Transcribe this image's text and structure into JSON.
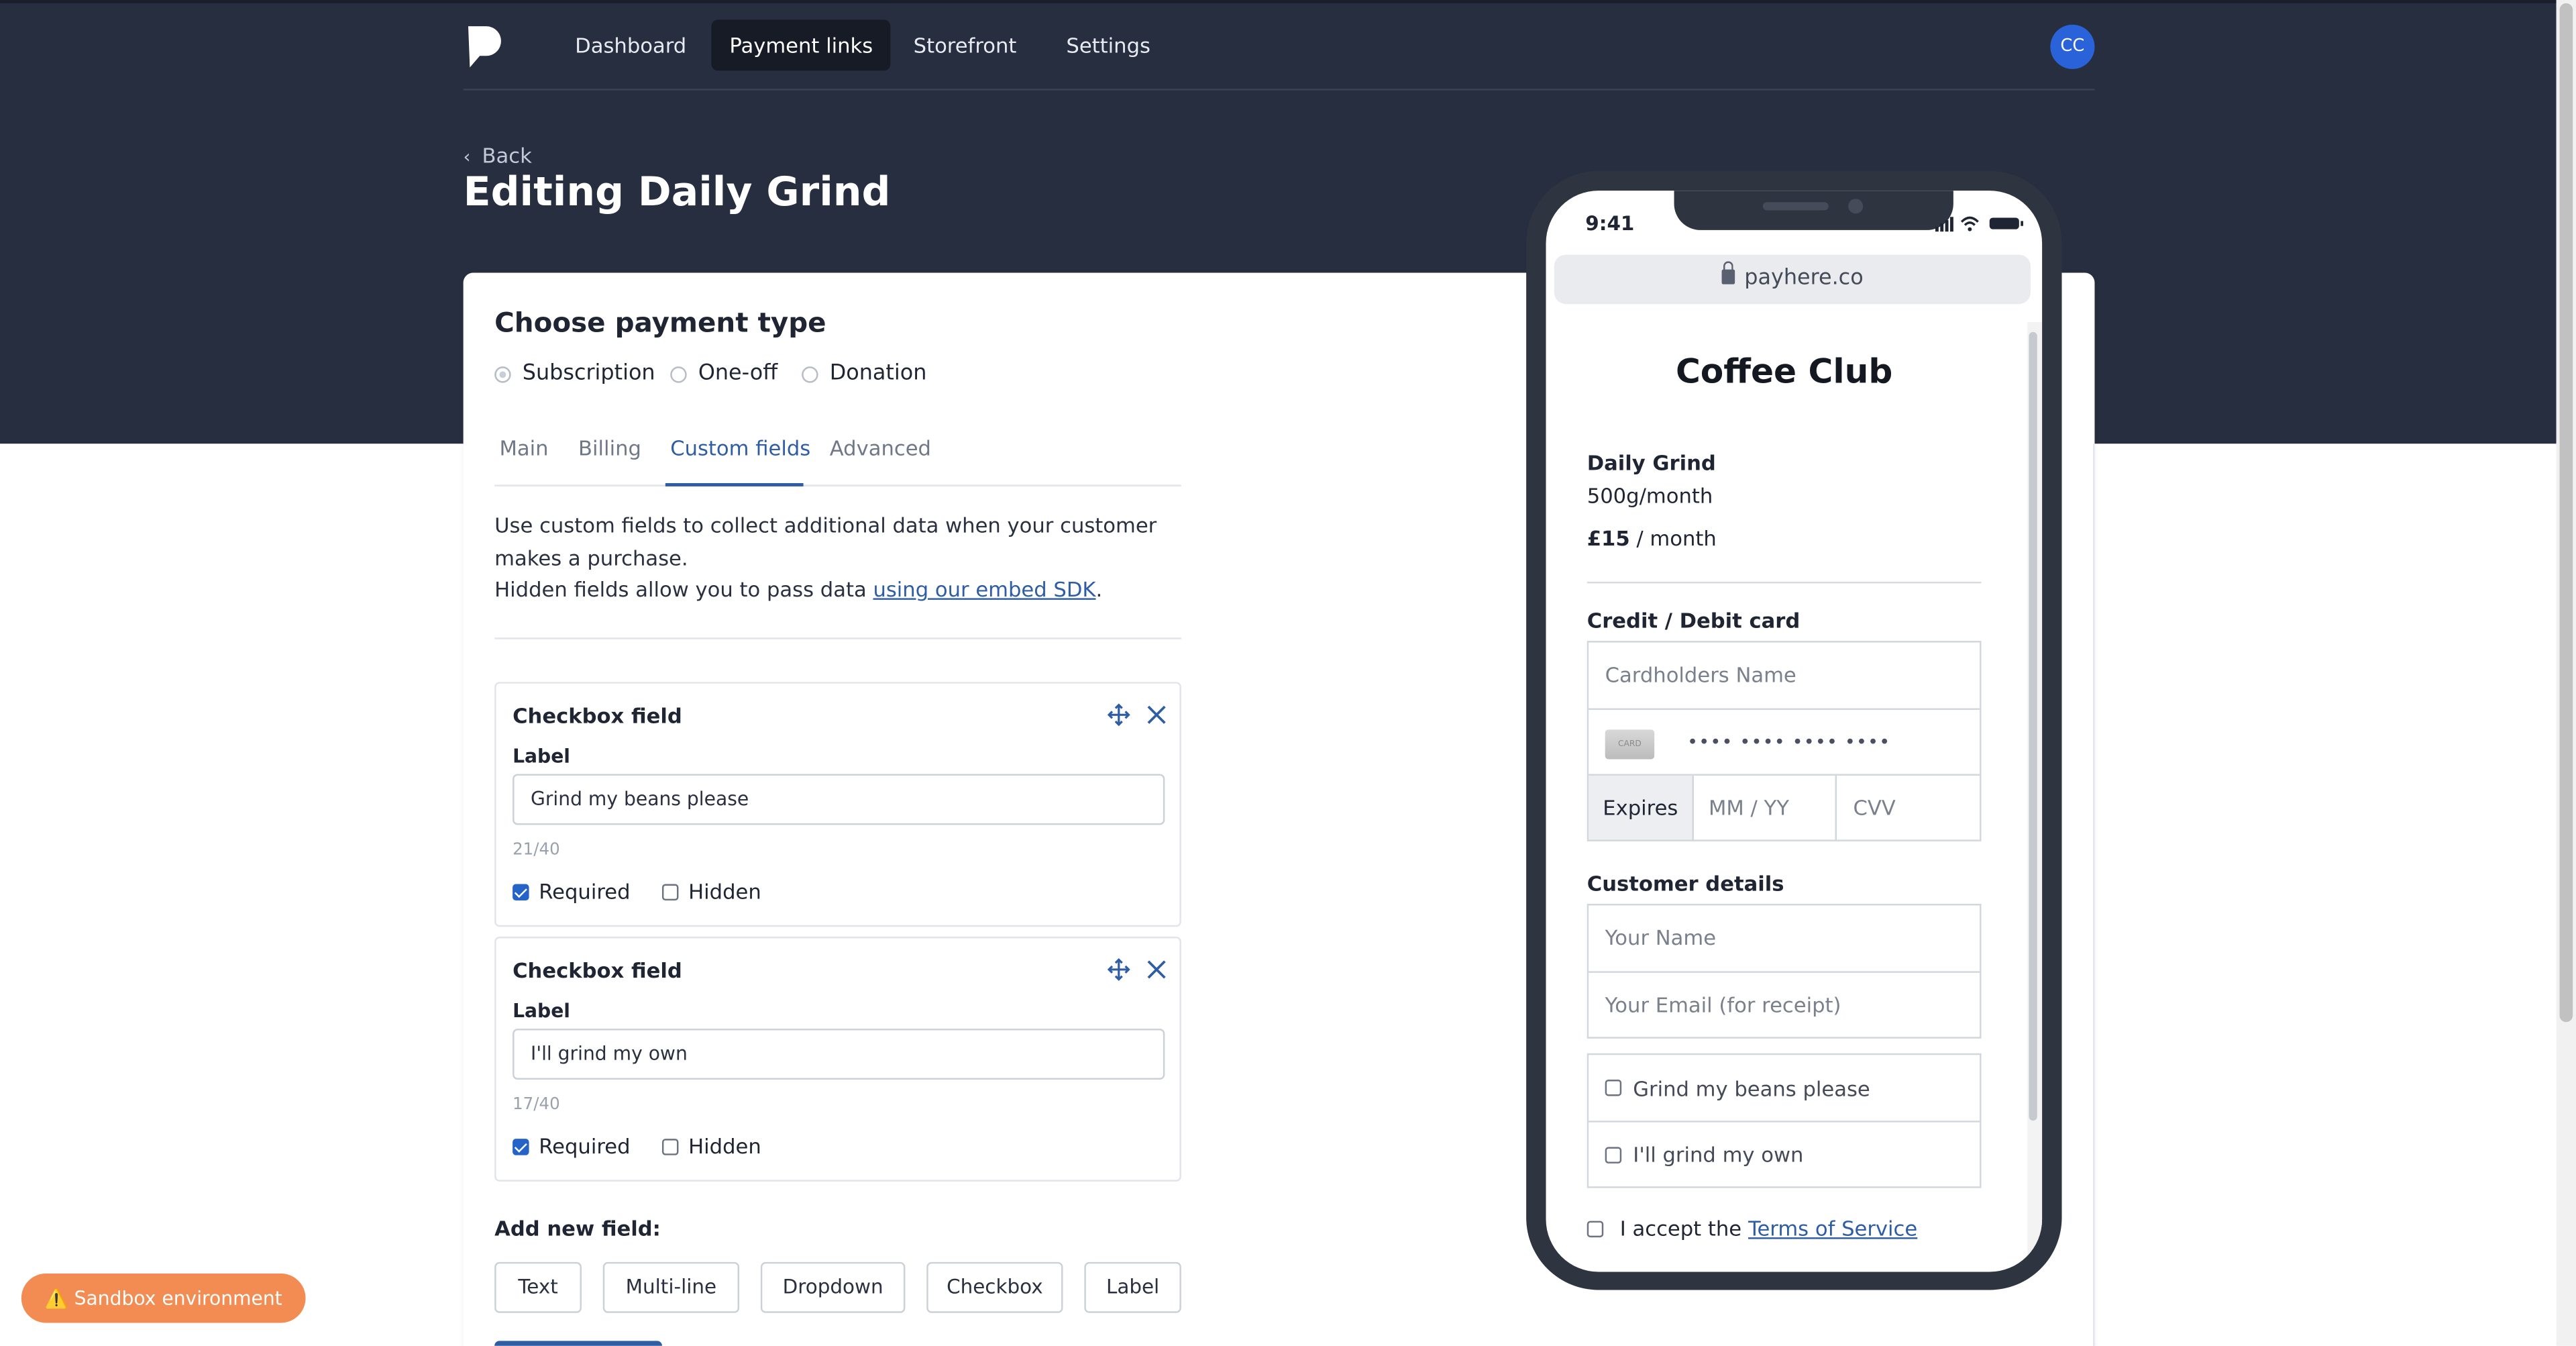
{
  "nav": {
    "items": [
      {
        "label": "Dashboard"
      },
      {
        "label": "Payment links"
      },
      {
        "label": "Storefront"
      },
      {
        "label": "Settings"
      }
    ],
    "active": "Payment links",
    "avatar_initials": "CC",
    "logo_icon": "payhere-logo-icon"
  },
  "header": {
    "back_label": "Back",
    "title": "Editing Daily Grind"
  },
  "payment_type": {
    "title": "Choose payment type",
    "options": [
      {
        "label": "Subscription",
        "selected": true
      },
      {
        "label": "One-off",
        "selected": false
      },
      {
        "label": "Donation",
        "selected": false
      }
    ]
  },
  "tabs": [
    {
      "label": "Main"
    },
    {
      "label": "Billing"
    },
    {
      "label": "Custom fields"
    },
    {
      "label": "Advanced"
    }
  ],
  "active_tab": "Custom fields",
  "custom_fields": {
    "description_line1": "Use custom fields to collect additional data when your customer makes a purchase.",
    "description_line2_prefix": "Hidden fields allow you to pass data ",
    "description_link": "using our embed SDK",
    "description_line2_suffix": ".",
    "fields": [
      {
        "type_title": "Checkbox field",
        "label_caption": "Label",
        "value": "Grind my beans please",
        "counter": "21/40",
        "required_label": "Required",
        "required": true,
        "hidden_label": "Hidden",
        "hidden": false
      },
      {
        "type_title": "Checkbox field",
        "label_caption": "Label",
        "value": "I'll grind my own",
        "counter": "17/40",
        "required_label": "Required",
        "required": true,
        "hidden_label": "Hidden",
        "hidden": false
      }
    ],
    "add_title": "Add new field:",
    "add_buttons": [
      {
        "label": "Text"
      },
      {
        "label": "Multi-line"
      },
      {
        "label": "Dropdown"
      },
      {
        "label": "Checkbox"
      },
      {
        "label": "Label"
      }
    ]
  },
  "sandbox_badge": "⚠️ Sandbox environment",
  "preview": {
    "time": "9:41",
    "url": "payhere.co",
    "shop_name": "Coffee Club",
    "product_name": "Daily Grind",
    "product_desc": "500g/month",
    "price_amount": "£15",
    "price_period": " / month",
    "card_section": "Credit / Debit card",
    "cardholder_placeholder": "Cardholders Name",
    "card_image_text": "CARD",
    "card_number_mask": "•••• •••• •••• ••••",
    "expires_label": "Expires",
    "expiry_placeholder": "MM / YY",
    "cvv_placeholder": "CVV",
    "customer_section": "Customer details",
    "name_placeholder": "Your Name",
    "email_placeholder": "Your Email (for receipt)",
    "custom_checkboxes": [
      {
        "label": "Grind my beans please"
      },
      {
        "label": "I'll grind my own"
      }
    ],
    "terms_prefix": "I accept the",
    "terms_link": "Terms of Service"
  },
  "colors": {
    "hero_bg": "#262e3f",
    "accent": "#2e5da6",
    "avatar_bg": "#2962d9",
    "sandbox_bg": "#f28c52",
    "checkbox_on": "#2563c9"
  }
}
